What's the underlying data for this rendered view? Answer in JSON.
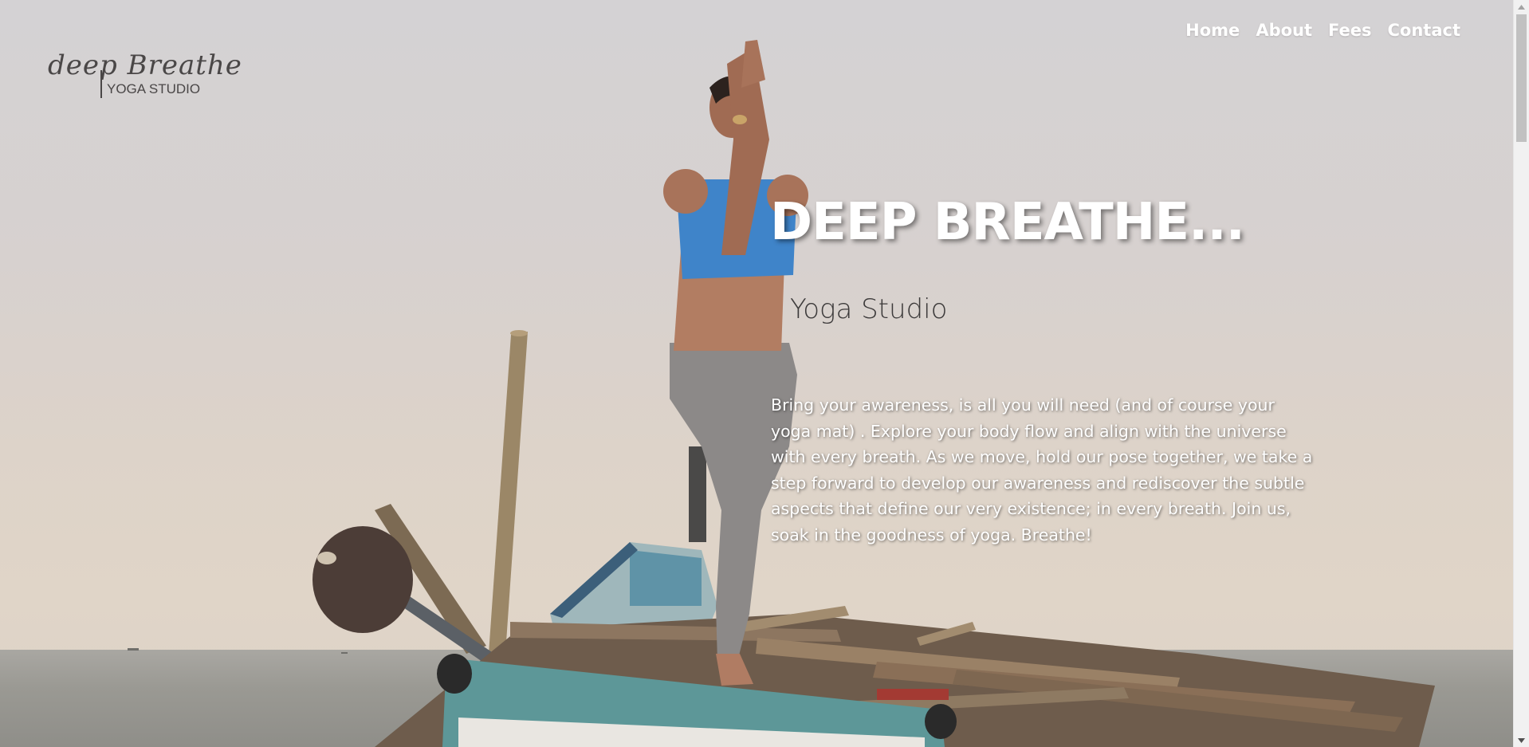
{
  "logo": {
    "script_text": "deep Breathe",
    "sub_text": "YOGA STUDIO"
  },
  "nav": {
    "items": [
      {
        "label": "Home"
      },
      {
        "label": "About"
      },
      {
        "label": "Fees"
      },
      {
        "label": "Contact"
      }
    ]
  },
  "hero": {
    "title": "DEEP BREATHE...",
    "subtitle": "Yoga Studio",
    "body": "Bring your awareness, is all you will need (and of course your yoga mat) . Explore your body flow and align with the universe with every breath. As we move, hold our pose together, we take a step forward to develop our awareness and rediscover the subtle aspects that define our very existence; in every breath. Join us, soak in the goodness of yoga. Breathe!"
  },
  "colors": {
    "nav_text": "#ffffff",
    "logo": "#4a4747",
    "top_wear": "#3f84c9",
    "leggings": "#8c8988",
    "boat_teal": "#5d9798"
  }
}
